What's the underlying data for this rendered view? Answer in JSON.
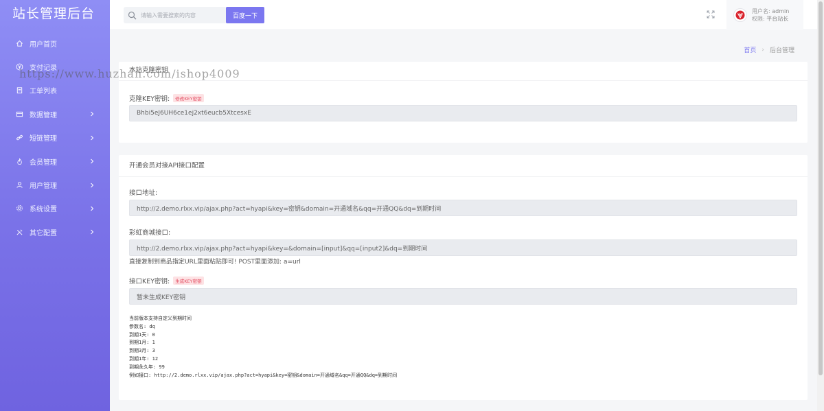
{
  "sidebar": {
    "brand": "站长管理后台",
    "items": [
      {
        "label": "用户首页",
        "icon": "home-icon",
        "has_children": false
      },
      {
        "label": "支付记录",
        "icon": "yen-icon",
        "has_children": false
      },
      {
        "label": "工单列表",
        "icon": "clipboard-icon",
        "has_children": false
      },
      {
        "label": "数据管理",
        "icon": "database-icon",
        "has_children": true
      },
      {
        "label": "短链管理",
        "icon": "link-icon",
        "has_children": true
      },
      {
        "label": "会员管理",
        "icon": "fire-icon",
        "has_children": true
      },
      {
        "label": "用户管理",
        "icon": "user-icon",
        "has_children": true
      },
      {
        "label": "系统设置",
        "icon": "gear-icon",
        "has_children": true
      },
      {
        "label": "其它配置",
        "icon": "tools-icon",
        "has_children": true
      }
    ]
  },
  "header": {
    "search_placeholder": "请输入需要搜索的内容",
    "search_button": "百度一下",
    "user": {
      "name_label": "用户名:",
      "name": "admin",
      "role_label": "权限:",
      "role": "平台站长"
    }
  },
  "breadcrumb": {
    "home": "首页",
    "current": "后台管理"
  },
  "card1": {
    "title": "本站克隆密钥",
    "key_label": "克隆KEY密钥:",
    "key_badge": "修改KEY密钥",
    "key_value": "Bhbi5eJ6UH6ce1ej2xt6eucb5XtcesxE"
  },
  "card2": {
    "title": "开通会员对接API接口配置",
    "api_label": "接口地址:",
    "api_value": "http://2.demo.rlxx.vip/ajax.php?act=hyapi&key=密钥&domain=开通域名&qq=开通QQ&dq=到期时间",
    "shop_label": "彩虹商城接口:",
    "shop_value": "http://2.demo.rlxx.vip/ajax.php?act=hyapi&key=&domain=[input]&qq=[input2]&dq=到期时间",
    "shop_hint": "直接复制到商品指定URL里面粘贴即可! POST里面添加: a=url",
    "key_label": "接口KEY密钥:",
    "key_badge": "生成KEY密钥",
    "key_value": "暂未生成KEY密钥",
    "notes": [
      "当前版本支持自定义到期时间",
      "参数名: dq",
      "到期1天: 0",
      "到期1月: 1",
      "到期3月: 3",
      "到期1年: 12",
      "到期永久年: 99",
      "例如接口: http://2.demo.rlxx.vip/ajax.php?act=hyapi&key=密钥&domain=开通域名&qq=开通QQ&dq=到期时间"
    ]
  },
  "watermark": "https://www.huzhan.com/ishop4009",
  "colors": {
    "accent": "#7b77f0",
    "sidebar_top": "#8f8ef5",
    "sidebar_bottom": "#6f63e0",
    "badge_text": "#e34b5f"
  }
}
